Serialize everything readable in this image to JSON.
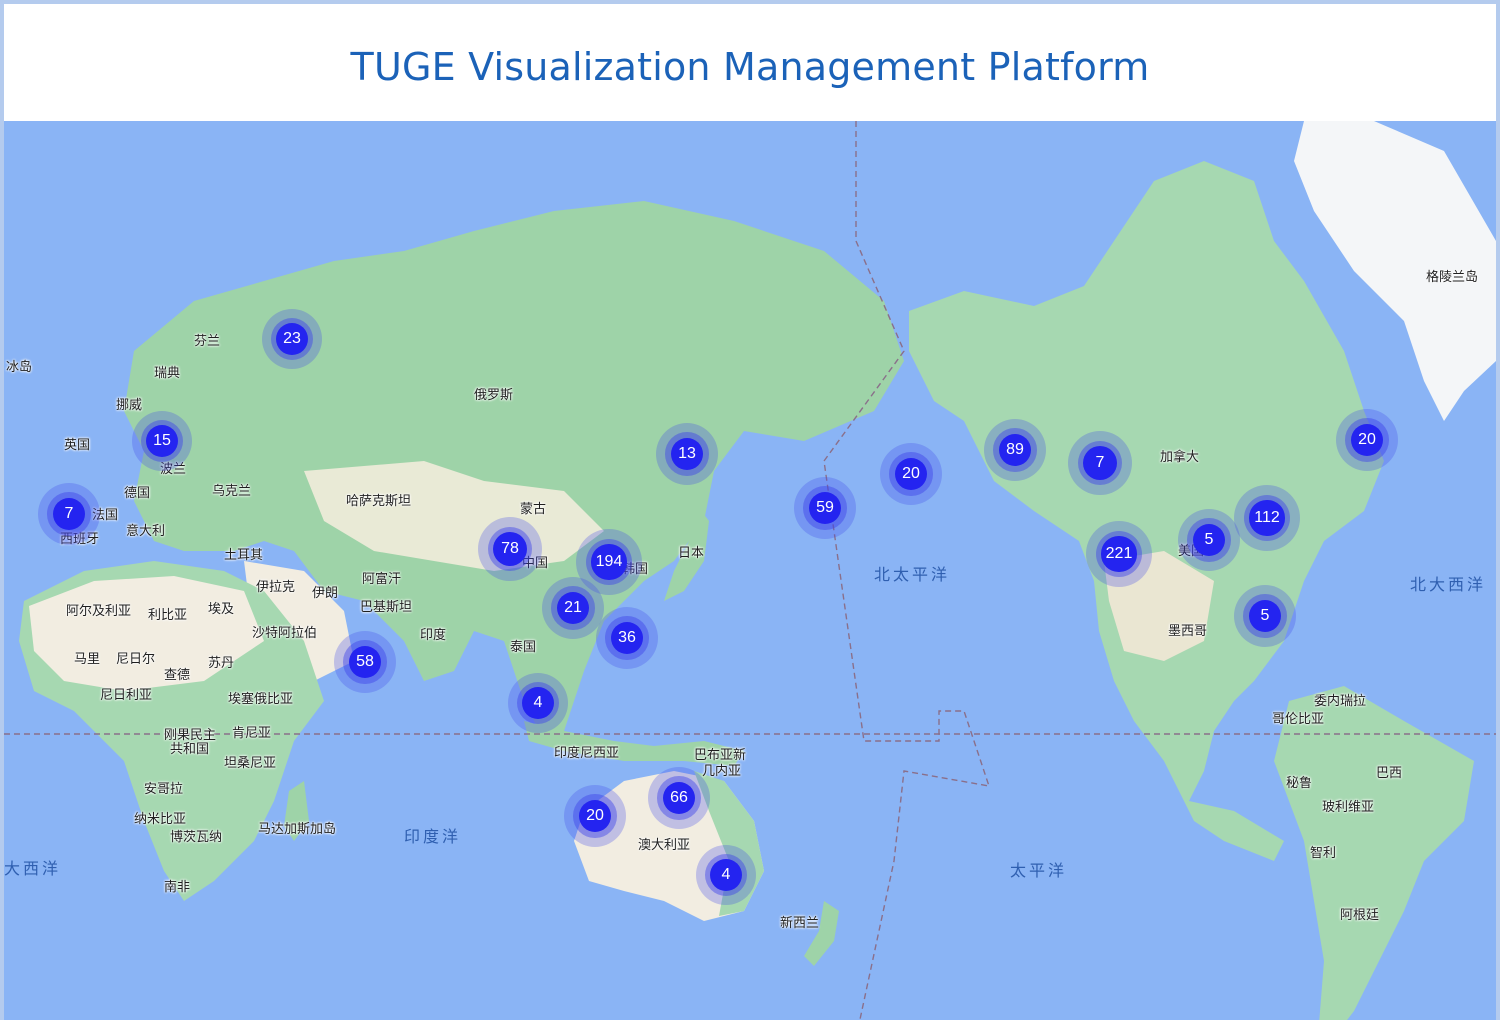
{
  "header": {
    "title": "TUGE Visualization Management Platform"
  },
  "colors": {
    "ocean": "#8ab4f5",
    "land": "#9ed3a8",
    "desert": "#f2ede1",
    "ice": "#f4f6f8",
    "cluster": "#2424f0",
    "title": "#1b62b8"
  },
  "oceans": [
    {
      "name": "北太平洋"
    },
    {
      "name": "北大西洋"
    },
    {
      "name": "印度洋"
    },
    {
      "name": "太平洋"
    },
    {
      "name": "大西洋"
    }
  ],
  "countries": [
    "冰岛",
    "芬兰",
    "瑞典",
    "挪威",
    "英国",
    "波兰",
    "乌克兰",
    "德国",
    "法国",
    "西班牙",
    "意大利",
    "俄罗斯",
    "哈萨克斯坦",
    "蒙古",
    "中国",
    "韩国",
    "日本",
    "土耳其",
    "伊拉克",
    "伊朗",
    "阿富汗",
    "巴基斯坦",
    "印度",
    "泰国",
    "阿尔及利亚",
    "利比亚",
    "埃及",
    "沙特阿拉伯",
    "马里",
    "尼日尔",
    "苏丹",
    "查德",
    "尼日利亚",
    "埃塞俄比亚",
    "刚果民主",
    "共和国",
    "肯尼亚",
    "坦桑尼亚",
    "安哥拉",
    "纳米比亚",
    "博茨瓦纳",
    "马达加斯加岛",
    "南非",
    "印度尼西亚",
    "巴布亚新",
    "几内亚",
    "澳大利亚",
    "新西兰",
    "加拿大",
    "美国",
    "墨西哥",
    "委内瑞拉",
    "哥伦比亚",
    "巴西",
    "秘鲁",
    "玻利维亚",
    "智利",
    "阿根廷",
    "格陵兰岛"
  ],
  "clusters": [
    "23",
    "15",
    "7",
    "13",
    "78",
    "194",
    "21",
    "36",
    "58",
    "4",
    "66",
    "20",
    "4",
    "59",
    "20",
    "89",
    "7",
    "221",
    "5",
    "112",
    "20",
    "5"
  ]
}
